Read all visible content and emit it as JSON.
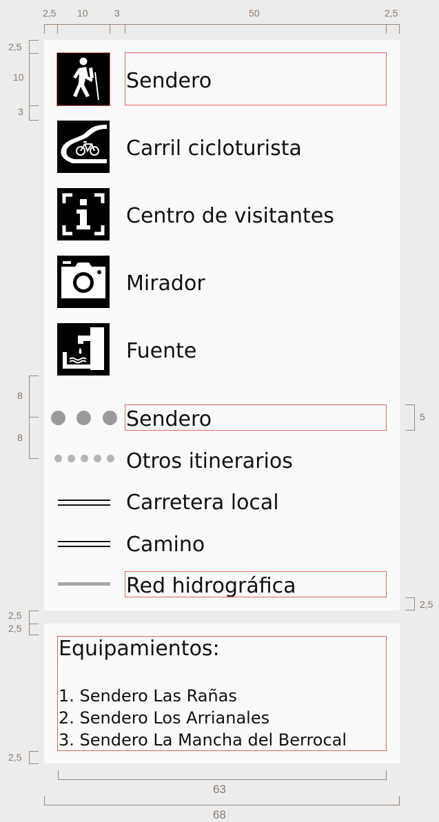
{
  "dimensions": {
    "top": [
      "2,5",
      "10",
      "3",
      "50",
      "2,5"
    ],
    "left_icon": [
      "2,5",
      "10",
      "3"
    ],
    "left_lines": [
      "8",
      "8"
    ],
    "right_line": "5",
    "right_bottom": "2,5",
    "left_eq": [
      "2,5",
      "2,5",
      "2,5"
    ],
    "bottom_inner": "63",
    "bottom_outer": "68"
  },
  "legend": {
    "symbols": [
      {
        "label": "Sendero",
        "icon": "hiker-icon"
      },
      {
        "label": "Carril cicloturista",
        "icon": "bike-lane-icon"
      },
      {
        "label": "Centro de visitantes",
        "icon": "info-center-icon"
      },
      {
        "label": "Mirador",
        "icon": "camera-icon"
      },
      {
        "label": "Fuente",
        "icon": "fountain-icon"
      }
    ],
    "lines": [
      {
        "label": "Sendero",
        "style": "large-dots"
      },
      {
        "label": "Otros itinerarios",
        "style": "small-dots"
      },
      {
        "label": "Carretera local",
        "style": "double-line"
      },
      {
        "label": "Camino",
        "style": "double-line"
      },
      {
        "label": "Red hidrográfica",
        "style": "grey-line"
      }
    ]
  },
  "equipment": {
    "title": "Equipamientos:",
    "items": [
      "1. Sendero Las Rañas",
      "2. Sendero Los Arrianales",
      "3. Sendero La Mancha del Berrocal"
    ]
  },
  "colors": {
    "guide": "#e0655c",
    "dimension": "#9b8a7c",
    "dot_grey": "#9a9a9a"
  }
}
